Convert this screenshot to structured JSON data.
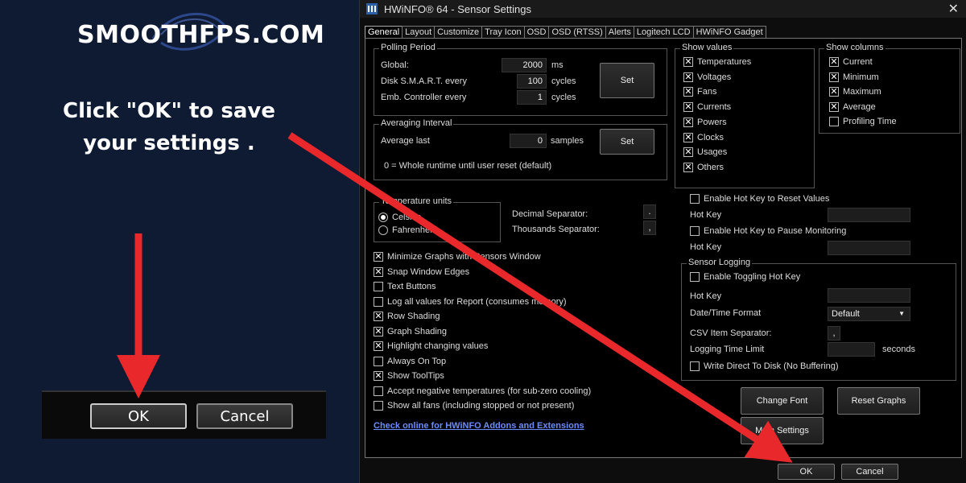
{
  "brand": {
    "text": "SMOOTHFPS.COM"
  },
  "instruction": {
    "line1": "Click \"OK\" to save",
    "line2": "your settings ."
  },
  "zoom": {
    "ok_label": "OK",
    "cancel_label": "Cancel"
  },
  "window": {
    "title": "HWiNFO® 64 - Sensor Settings",
    "close_glyph": "✕"
  },
  "tabs": [
    "General",
    "Layout",
    "Customize",
    "Tray Icon",
    "OSD",
    "OSD (RTSS)",
    "Alerts",
    "Logitech LCD",
    "HWiNFO Gadget"
  ],
  "polling": {
    "title": "Polling Period",
    "global_label": "Global:",
    "global_value": "2000",
    "global_unit": "ms",
    "smart_label": "Disk S.M.A.R.T. every",
    "smart_value": "100",
    "smart_unit": "cycles",
    "ec_label": "Emb. Controller every",
    "ec_value": "1",
    "ec_unit": "cycles",
    "set_label": "Set"
  },
  "averaging": {
    "title": "Averaging Interval",
    "avg_label": "Average last",
    "avg_value": "0",
    "avg_unit": "samples",
    "note": "0 = Whole runtime until user reset (default)",
    "set_label": "Set"
  },
  "temperature": {
    "title": "Temperature units",
    "celsius": "Celsius",
    "fahrenheit": "Fahrenheit",
    "decimal_label": "Decimal Separator:",
    "decimal_value": ".",
    "thousands_label": "Thousands Separator:",
    "thousands_value": ","
  },
  "options": [
    {
      "label": "Minimize Graphs with Sensors Window",
      "checked": true
    },
    {
      "label": "Snap Window Edges",
      "checked": true
    },
    {
      "label": "Text Buttons",
      "checked": false
    },
    {
      "label": "Log all values for Report (consumes memory)",
      "checked": false
    },
    {
      "label": "Row Shading",
      "checked": true
    },
    {
      "label": "Graph Shading",
      "checked": true
    },
    {
      "label": "Highlight changing values",
      "checked": true
    },
    {
      "label": "Always On Top",
      "checked": false
    },
    {
      "label": "Show ToolTips",
      "checked": true
    },
    {
      "label": "Accept negative temperatures (for sub-zero cooling)",
      "checked": false
    },
    {
      "label": "Show all fans (including stopped or not present)",
      "checked": false
    }
  ],
  "addons_link": "Check online for HWiNFO Addons and Extensions",
  "show_values": {
    "title": "Show values",
    "items": [
      "Temperatures",
      "Voltages",
      "Fans",
      "Currents",
      "Powers",
      "Clocks",
      "Usages",
      "Others"
    ]
  },
  "show_columns": {
    "title": "Show columns",
    "items": [
      {
        "label": "Current",
        "checked": true
      },
      {
        "label": "Minimum",
        "checked": true
      },
      {
        "label": "Maximum",
        "checked": true
      },
      {
        "label": "Average",
        "checked": true
      },
      {
        "label": "Profiling Time",
        "checked": false
      }
    ]
  },
  "hotkeys": {
    "reset_label": "Enable Hot Key to Reset Values",
    "hotkey_label": "Hot Key",
    "pause_label": "Enable Hot Key to Pause Monitoring"
  },
  "logging": {
    "title": "Sensor Logging",
    "toggle_label": "Enable Toggling Hot Key",
    "hotkey_label": "Hot Key",
    "datetime_label": "Date/Time Format",
    "datetime_value": "Default",
    "csv_label": "CSV Item Separator:",
    "csv_value": ",",
    "limit_label": "Logging Time Limit",
    "limit_unit": "seconds",
    "direct_label": "Write Direct To Disk (No Buffering)"
  },
  "buttons": {
    "change_font": "Change Font",
    "reset_graphs": "Reset Graphs",
    "main_settings": "Main Settings",
    "ok": "OK",
    "cancel": "Cancel"
  },
  "colors": {
    "arrow": "#e8282b",
    "background": "#0f1a33",
    "link": "#6a8cff"
  }
}
